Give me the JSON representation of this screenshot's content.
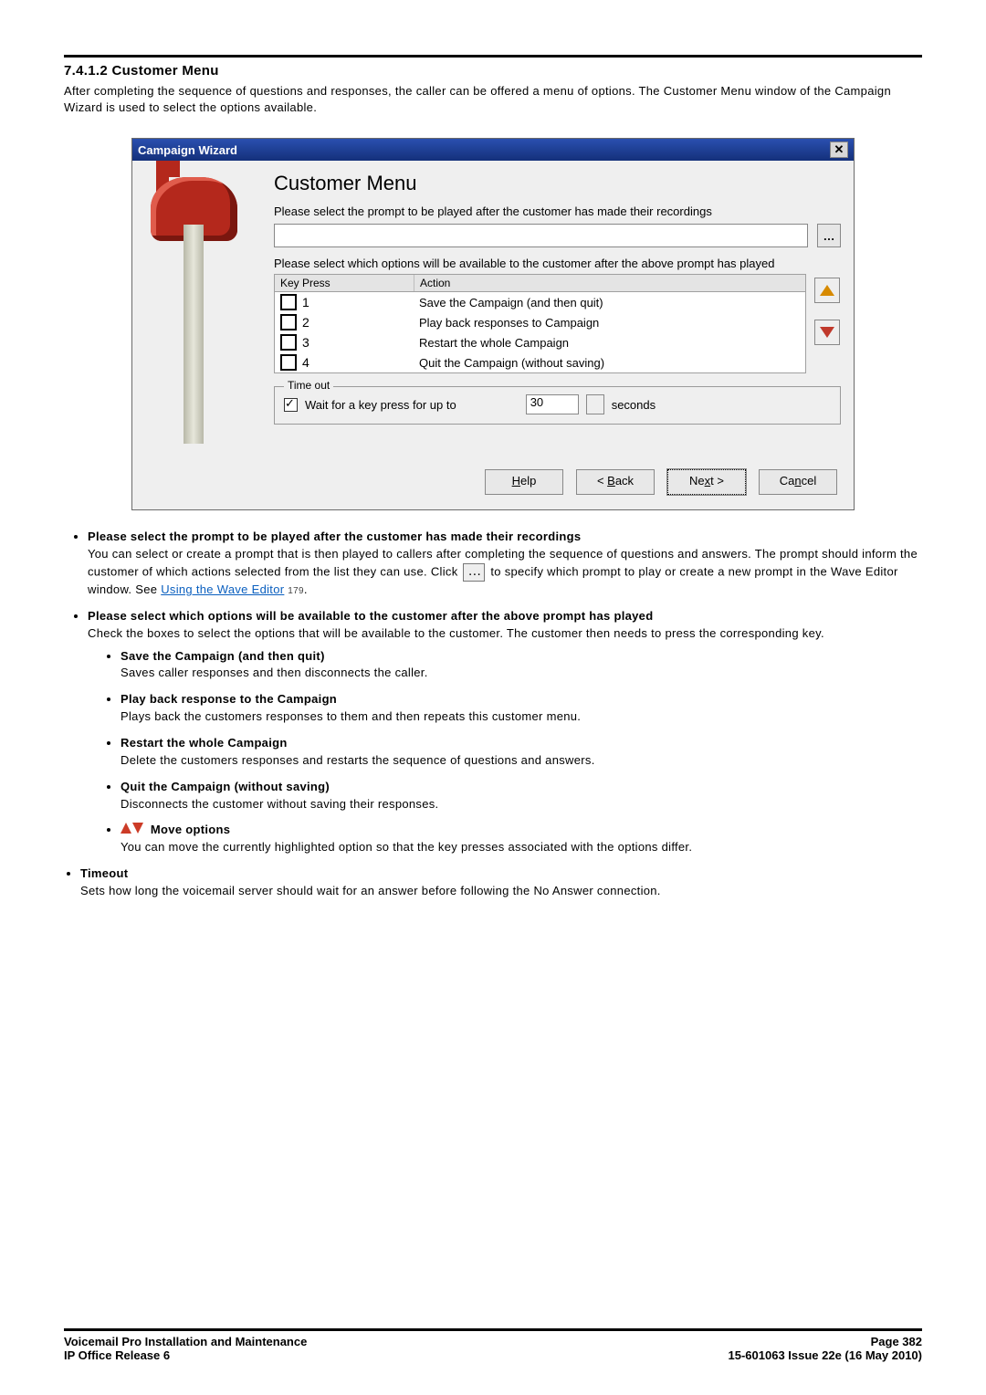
{
  "section": {
    "number": "7.4.1.2",
    "title": "Customer Menu"
  },
  "intro": "After completing the sequence of questions and responses, the caller can be offered a menu of options. The Customer Menu window of the Campaign Wizard is used to select the options available.",
  "dialog": {
    "title": "Campaign Wizard",
    "heading": "Customer Menu",
    "prompt1": "Please select the prompt to be played after the customer has made their recordings",
    "prompt2": "Please select which options will be available to the customer after the above prompt has played",
    "cols": {
      "key": "Key Press",
      "action": "Action"
    },
    "rows": [
      {
        "key": "1",
        "action": "Save the Campaign (and then quit)"
      },
      {
        "key": "2",
        "action": "Play back responses to Campaign"
      },
      {
        "key": "3",
        "action": "Restart the whole Campaign"
      },
      {
        "key": "4",
        "action": "Quit the Campaign (without saving)"
      }
    ],
    "timeout": {
      "legend": "Time out",
      "label": "Wait for a key press for up to",
      "value": "30",
      "unit": "seconds"
    },
    "buttons": {
      "help": "Help",
      "back": "< Back",
      "next": "Next >",
      "cancel": "Cancel"
    }
  },
  "copy": {
    "b1_title": "Please select the prompt to be played after the customer has made their recordings",
    "b1_1": "You can select or create a prompt that is then played to callers after completing the sequence of questions and answers. The prompt should inform the customer of which actions selected from the list they can use. Click ",
    "b1_2": " to specify which prompt to play or create a new prompt in the Wave Editor window. See ",
    "b1_link": "Using the Wave Editor",
    "b1_ref": "179",
    "b1_3": ".",
    "b2_title": "Please select which options will be available to the customer after the above prompt has played",
    "b2_text": "Check the boxes to select the options that will be available to the customer. The customer then needs to press the corresponding key.",
    "s1_title": "Save the Campaign (and then quit)",
    "s1": "Saves caller responses and then disconnects the caller.",
    "s2_title": "Play back response to the Campaign",
    "s2": "Plays back the customers responses to them and then repeats this customer menu.",
    "s3_title": "Restart the whole Campaign",
    "s3": "Delete the customers responses and restarts the sequence of questions and answers.",
    "s4_title": "Quit the Campaign (without saving)",
    "s4": "Disconnects the customer without saving their responses.",
    "s5_title": "Move options",
    "s5": "You can move the currently highlighted option so that the key presses associated with the options differ.",
    "t_title": "Timeout",
    "t": "Sets how long the voicemail server should wait for an answer before following the No Answer connection."
  },
  "footer": {
    "left1": "Voicemail Pro Installation and Maintenance",
    "left2": "IP Office Release 6",
    "right1": "Page 382",
    "right2": "15-601063 Issue 22e (16 May 2010)"
  }
}
